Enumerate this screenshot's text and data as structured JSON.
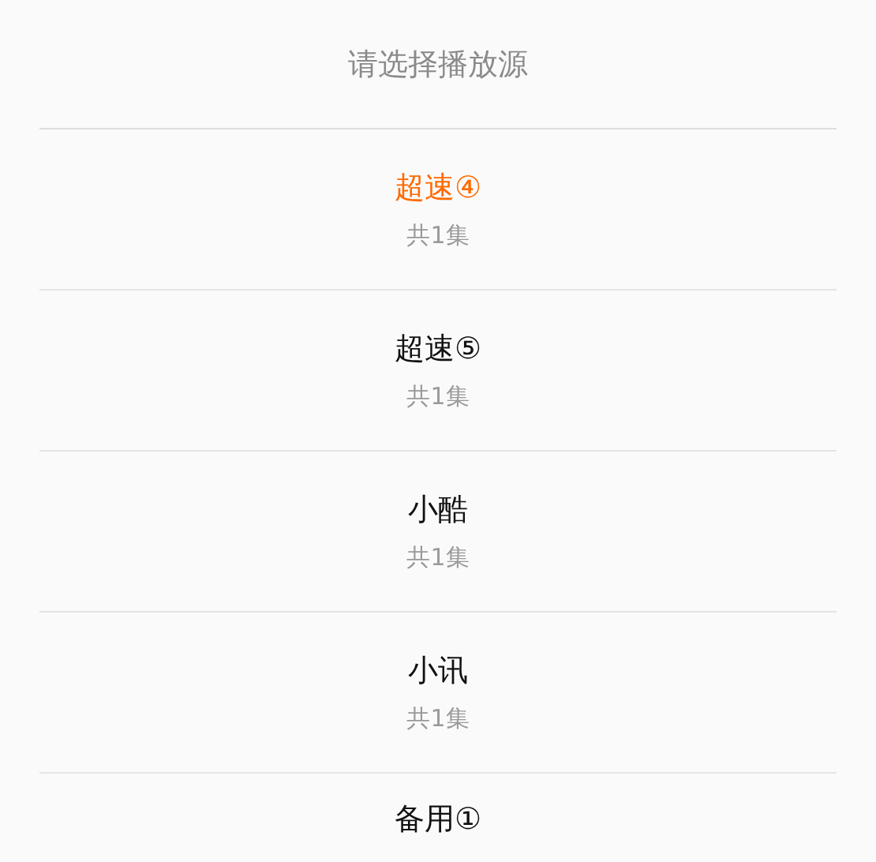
{
  "title": "请选择播放源",
  "sources": [
    {
      "name": "超速④",
      "count": "共1集",
      "selected": true
    },
    {
      "name": "超速⑤",
      "count": "共1集",
      "selected": false
    },
    {
      "name": "小酷",
      "count": "共1集",
      "selected": false
    },
    {
      "name": "小讯",
      "count": "共1集",
      "selected": false
    },
    {
      "name": "备用①",
      "selected": false
    }
  ]
}
